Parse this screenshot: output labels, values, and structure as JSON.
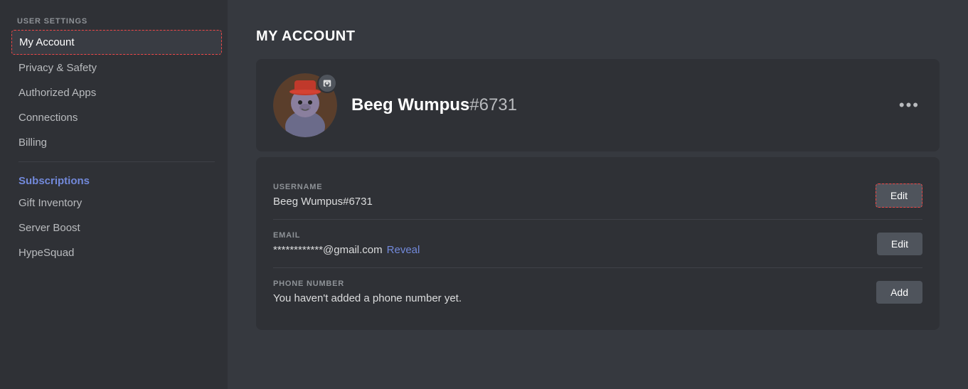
{
  "sidebar": {
    "section_label": "USER SETTINGS",
    "items": [
      {
        "id": "my-account",
        "label": "My Account",
        "active": true
      },
      {
        "id": "privacy-safety",
        "label": "Privacy & Safety",
        "active": false
      },
      {
        "id": "authorized-apps",
        "label": "Authorized Apps",
        "active": false
      },
      {
        "id": "connections",
        "label": "Connections",
        "active": false
      },
      {
        "id": "billing",
        "label": "Billing",
        "active": false
      }
    ],
    "subscriptions_label": "Subscriptions",
    "subscription_items": [
      {
        "id": "gift-inventory",
        "label": "Gift Inventory"
      },
      {
        "id": "server-boost",
        "label": "Server Boost"
      },
      {
        "id": "hypesquad",
        "label": "HypeSquad"
      }
    ]
  },
  "main": {
    "page_title": "MY ACCOUNT",
    "profile": {
      "username": "Beeg Wumpus",
      "discriminator": "#6731",
      "more_button": "•••"
    },
    "fields": {
      "username": {
        "label": "USERNAME",
        "value": "Beeg Wumpus#6731",
        "edit_label": "Edit"
      },
      "email": {
        "label": "EMAIL",
        "masked": "************@gmail.com",
        "reveal_label": "Reveal",
        "edit_label": "Edit"
      },
      "phone": {
        "label": "PHONE NUMBER",
        "value": "You haven't added a phone number yet.",
        "add_label": "Add"
      }
    }
  },
  "colors": {
    "accent": "#7289da",
    "danger": "#f04747",
    "muted": "#8e9297"
  }
}
